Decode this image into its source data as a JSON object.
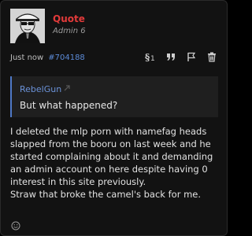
{
  "post": {
    "author": "Quote",
    "role": "Admin 6",
    "timestamp": "Just now",
    "post_number": "#704188",
    "actions": [
      "reply-icon",
      "quote-icon",
      "flag-icon",
      "trash-icon"
    ],
    "quote": {
      "author": "RebelGun",
      "body": "But what happened?"
    },
    "message": [
      "I deleted the mlp porn with namefag heads slapped from the booru on last week and he started complaining about it and demanding an admin account on here despite having 0 interest in this site previously.",
      "Straw that broke the camel's back for me."
    ],
    "reaction_icon": "smiley-icon"
  },
  "colors": {
    "author": "#e23a3a",
    "link": "#5b8ad6",
    "quote_accent": "#4f79c7",
    "background": "#121212"
  }
}
